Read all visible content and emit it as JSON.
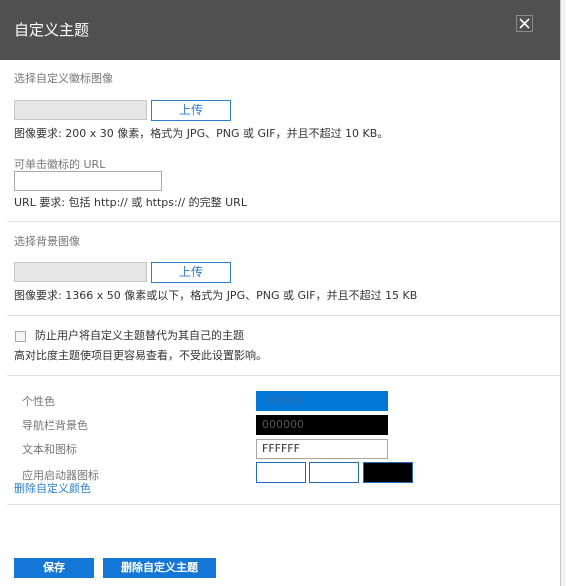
{
  "dialog": {
    "title": "自定义主题",
    "close_icon": "close-icon"
  },
  "logo_section": {
    "label": "选择自定义徽标图像",
    "file_value": "",
    "upload_label": "上传",
    "requirement": "图像要求: 200 x 30 像素，格式为 JPG、PNG 或 GIF，并且不超过 10 KB。",
    "url_label": "可单击徽标的 URL",
    "url_value": "",
    "url_requirement": "URL 要求: 包括 http:// 或 https:// 的完整 URL"
  },
  "background_section": {
    "label": "选择背景图像",
    "file_value": "",
    "upload_label": "上传",
    "requirement": "图像要求: 1366 x 50 像素或以下，格式为 JPG、PNG 或 GIF，并且不超过 15 KB"
  },
  "override_section": {
    "checkbox_label": "防止用户将自定义主题替代为其自己的主题",
    "checked": false,
    "note": "高对比度主题使项目更容易查看，不受此设置影响。"
  },
  "colors": {
    "accent_label": "个性色",
    "accent_value": "0078D7",
    "accent_color": "#0078d7",
    "nav_bg_label": "导航栏背景色",
    "nav_bg_value": "000000",
    "nav_bg_color": "#000000",
    "text_icons_label": "文本和图标",
    "text_icons_value": "FFFFFF",
    "launcher_label": "应用启动器图标",
    "launcher_swatches": [
      "#ffffff",
      "#ffffff",
      "#000000"
    ],
    "remove_colors_link": "删除自定义颜色"
  },
  "footer": {
    "save_label": "保存",
    "remove_theme_label": "删除自定义主题"
  }
}
